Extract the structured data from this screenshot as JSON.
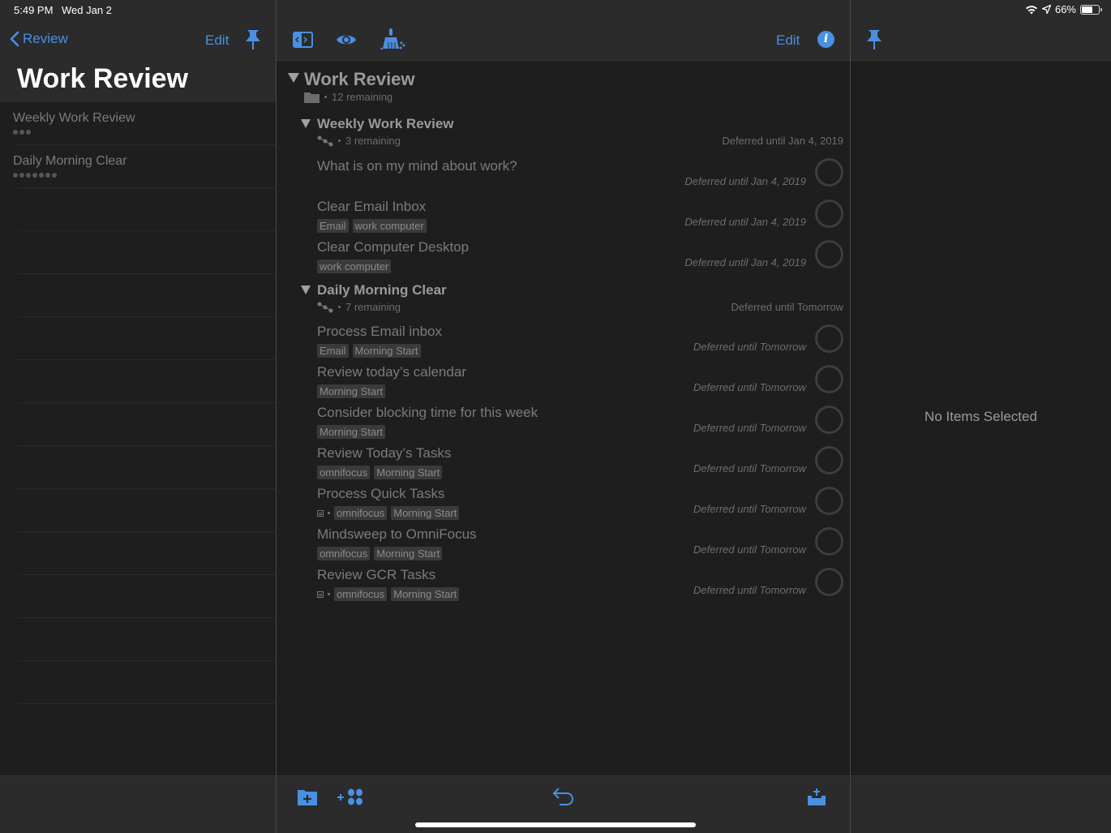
{
  "status_bar": {
    "time": "5:49 PM",
    "date": "Wed Jan 2",
    "battery_percent_label": "66%",
    "battery_level": 0.66,
    "icons": [
      "wifi-icon",
      "location-icon",
      "battery-icon"
    ]
  },
  "sidebar": {
    "back_label": "Review",
    "edit_label": "Edit",
    "title": "Work Review",
    "items": [
      {
        "label": "Weekly Work Review",
        "dot_count": 3
      },
      {
        "label": "Daily Morning Clear",
        "dot_count": 7
      }
    ]
  },
  "toolbar": {
    "icons": [
      "sidebar-toggle-icon",
      "view-options-icon",
      "clean-up-icon"
    ],
    "edit_label": "Edit",
    "info_icon": "info-icon"
  },
  "outline": {
    "folder": {
      "title": "Work Review",
      "remaining": "12 remaining"
    },
    "projects": [
      {
        "title": "Weekly Work Review",
        "remaining": "3 remaining",
        "defer": "Deferred until Jan 4, 2019",
        "tasks": [
          {
            "title": "What is on my mind about work?",
            "tags": [],
            "has_note": false,
            "defer": "Deferred until Jan 4, 2019"
          },
          {
            "title": "Clear Email Inbox",
            "tags": [
              "Email",
              "work computer"
            ],
            "has_note": false,
            "defer": "Deferred until Jan 4, 2019"
          },
          {
            "title": "Clear Computer Desktop",
            "tags": [
              "work computer"
            ],
            "has_note": false,
            "defer": "Deferred until Jan 4, 2019"
          }
        ]
      },
      {
        "title": "Daily Morning Clear",
        "remaining": "7 remaining",
        "defer": "Deferred until Tomorrow",
        "tasks": [
          {
            "title": "Process Email inbox",
            "tags": [
              "Email",
              "Morning Start"
            ],
            "has_note": false,
            "defer": "Deferred until Tomorrow"
          },
          {
            "title": "Review today’s calendar",
            "tags": [
              "Morning Start"
            ],
            "has_note": false,
            "defer": "Deferred until Tomorrow"
          },
          {
            "title": "Consider blocking time for this week",
            "tags": [
              "Morning Start"
            ],
            "has_note": false,
            "defer": "Deferred until Tomorrow"
          },
          {
            "title": "Review Today’s Tasks",
            "tags": [
              "omnifocus",
              "Morning Start"
            ],
            "has_note": false,
            "defer": "Deferred until Tomorrow"
          },
          {
            "title": "Process Quick Tasks",
            "tags": [
              "omnifocus",
              "Morning Start"
            ],
            "has_note": true,
            "defer": "Deferred until Tomorrow"
          },
          {
            "title": "Mindsweep to OmniFocus",
            "tags": [
              "omnifocus",
              "Morning Start"
            ],
            "has_note": false,
            "defer": "Deferred until Tomorrow"
          },
          {
            "title": "Review GCR Tasks",
            "tags": [
              "omnifocus",
              "Morning Start"
            ],
            "has_note": true,
            "defer": "Deferred until Tomorrow"
          }
        ]
      }
    ]
  },
  "bottom_toolbar": {
    "icons": [
      "new-folder-icon",
      "new-action-group-icon",
      "undo-icon",
      "inbox-add-icon"
    ]
  },
  "inspector": {
    "empty_message": "No Items Selected"
  },
  "colors": {
    "accent": "#4a90e2",
    "background": "#1e1e1e",
    "header": "#2b2b2b"
  }
}
